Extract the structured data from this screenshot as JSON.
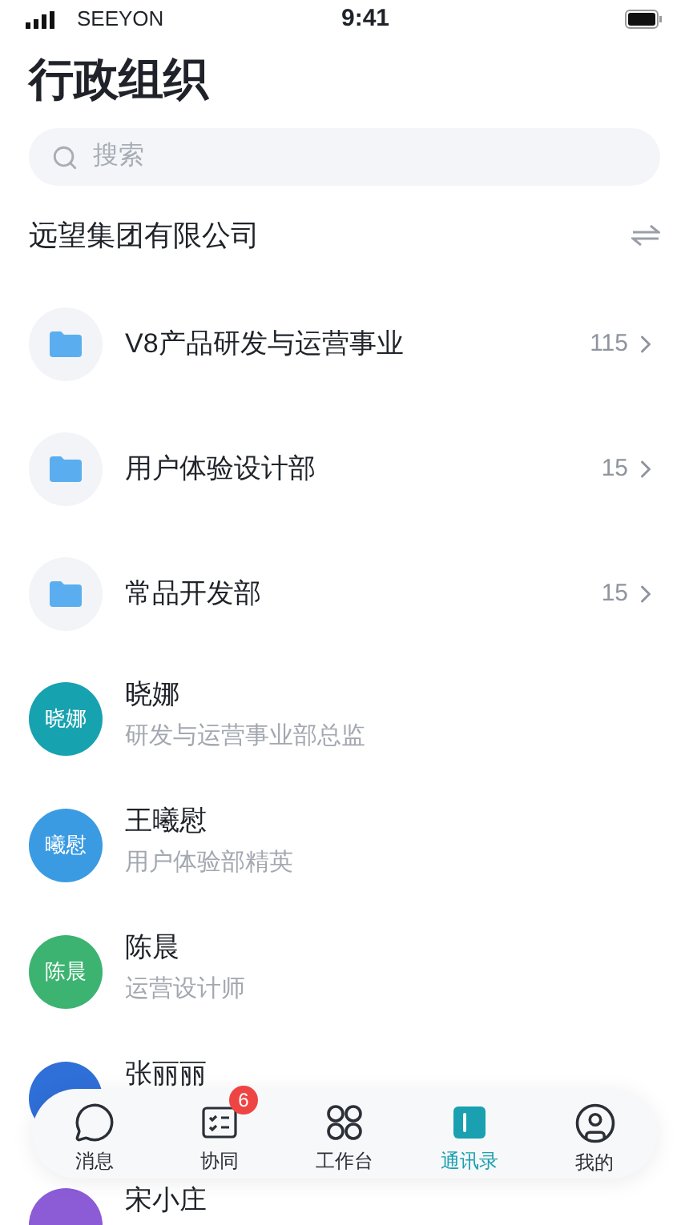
{
  "status_bar": {
    "carrier": "SEEYON",
    "time": "9:41"
  },
  "title": "行政组织",
  "search": {
    "placeholder": "搜索"
  },
  "organization": {
    "name": "远望集团有限公司"
  },
  "departments": [
    {
      "name": "V8产品研发与运营事业",
      "count": "115"
    },
    {
      "name": "用户体验设计部",
      "count": "15"
    },
    {
      "name": "常品开发部",
      "count": "15"
    }
  ],
  "people": [
    {
      "name": "晓娜",
      "avatar_text": "晓娜",
      "title": "研发与运营事业部总监",
      "color": "#17a2b0"
    },
    {
      "name": "王曦慰",
      "avatar_text": "曦慰",
      "title": "用户体验部精英",
      "color": "#3a9be2"
    },
    {
      "name": "陈晨",
      "avatar_text": "陈晨",
      "title": "运营设计师",
      "color": "#3cb371"
    },
    {
      "name": "张丽丽",
      "color": "#2f6fd8"
    },
    {
      "name": "宋小庄",
      "color": "#8b5cd6"
    }
  ],
  "tab_bar": [
    {
      "kind": "messages",
      "label": "消息",
      "selected": false
    },
    {
      "kind": "tasks",
      "label": "协同",
      "selected": false,
      "badge": "6"
    },
    {
      "kind": "workbench",
      "label": "工作台",
      "selected": false
    },
    {
      "kind": "contacts",
      "label": "通讯录",
      "selected": true
    },
    {
      "kind": "profile",
      "label": "我的",
      "selected": false
    }
  ]
}
